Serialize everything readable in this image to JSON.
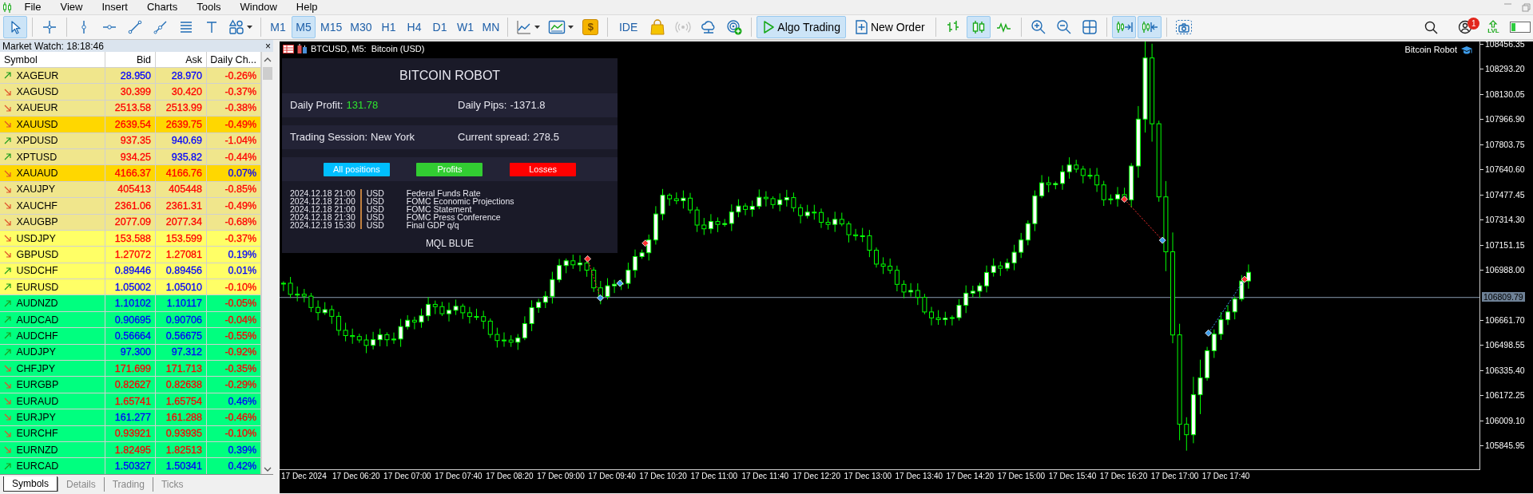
{
  "menu": [
    {
      "label": "File"
    },
    {
      "label": "View"
    },
    {
      "label": "Insert"
    },
    {
      "label": "Charts"
    },
    {
      "label": "Tools"
    },
    {
      "label": "Window"
    },
    {
      "label": "Help"
    }
  ],
  "toolbar": {
    "drawing_tools": [
      {
        "selected": true
      },
      {
        "selected": false
      },
      {
        "selected": false
      },
      {
        "selected": false
      },
      {
        "selected": false
      },
      {
        "selected": false
      },
      {
        "selected": false
      },
      {
        "selected": false
      },
      {
        "selected": false
      }
    ],
    "timeframes": [
      {
        "label": "M1",
        "selected": false
      },
      {
        "label": "M5",
        "selected": true
      },
      {
        "label": "M15",
        "selected": false
      },
      {
        "label": "M30",
        "selected": false
      },
      {
        "label": "H1",
        "selected": false
      },
      {
        "label": "H4",
        "selected": false
      },
      {
        "label": "D1",
        "selected": false
      },
      {
        "label": "W1",
        "selected": false
      },
      {
        "label": "MN",
        "selected": false
      }
    ],
    "dollar_symbol": "$",
    "ide": "IDE",
    "signals": {
      "disabled": true
    },
    "algo_trading": {
      "label": "Algo Trading",
      "on": true
    },
    "new_order": "New Order",
    "chart_types": [
      {
        "selected": false
      },
      {
        "selected": true
      },
      {
        "selected": false
      }
    ],
    "auto_scroll": {
      "on": true
    },
    "chart_shift": {
      "on": true
    },
    "notifications": "1",
    "lvl": {
      "label": "LVL",
      "level": 0.22
    }
  },
  "market_watch": {
    "title": "Market Watch: 18:18:46",
    "close": "×",
    "columns": [
      "Symbol",
      "Bid",
      "Ask",
      "Daily Ch..."
    ],
    "rows": [
      {
        "symbol": "XAGEUR",
        "kind": "up",
        "bid": {
          "value": "28.950",
          "color": "#0000ff"
        },
        "ask": {
          "value": "28.970",
          "color": "#0000ff"
        },
        "change": {
          "value": "-0.26%",
          "color": "#ff0000"
        },
        "color": "#f0e68c"
      },
      {
        "symbol": "XAGUSD",
        "kind": "down",
        "bid": {
          "value": "30.399",
          "color": "#ff0000"
        },
        "ask": {
          "value": "30.420",
          "color": "#ff0000"
        },
        "change": {
          "value": "-0.37%",
          "color": "#ff0000"
        },
        "color": "#f0e68c"
      },
      {
        "symbol": "XAUEUR",
        "kind": "down",
        "bid": {
          "value": "2513.58",
          "color": "#ff0000"
        },
        "ask": {
          "value": "2513.99",
          "color": "#ff0000"
        },
        "change": {
          "value": "-0.38%",
          "color": "#ff0000"
        },
        "color": "#f0e68c"
      },
      {
        "symbol": "XAUUSD",
        "kind": "down",
        "bid": {
          "value": "2639.54",
          "color": "#ff0000"
        },
        "ask": {
          "value": "2639.75",
          "color": "#ff0000"
        },
        "change": {
          "value": "-0.49%",
          "color": "#ff0000"
        },
        "color": "#ffd700"
      },
      {
        "symbol": "XPDUSD",
        "kind": "up",
        "bid": {
          "value": "937.35",
          "color": "#ff0000"
        },
        "ask": {
          "value": "940.69",
          "color": "#0000ff"
        },
        "change": {
          "value": "-1.04%",
          "color": "#ff0000"
        },
        "color": "#f0e68c"
      },
      {
        "symbol": "XPTUSD",
        "kind": "up",
        "bid": {
          "value": "934.25",
          "color": "#ff0000"
        },
        "ask": {
          "value": "935.82",
          "color": "#0000ff"
        },
        "change": {
          "value": "-0.44%",
          "color": "#ff0000"
        },
        "color": "#f0e68c"
      },
      {
        "symbol": "XAUAUD",
        "kind": "down",
        "bid": {
          "value": "4166.37",
          "color": "#ff0000"
        },
        "ask": {
          "value": "4166.76",
          "color": "#ff0000"
        },
        "change": {
          "value": "0.07%",
          "color": "#0000ff"
        },
        "color": "#ffd700"
      },
      {
        "symbol": "XAUJPY",
        "kind": "down",
        "bid": {
          "value": "405413",
          "color": "#ff0000"
        },
        "ask": {
          "value": "405448",
          "color": "#ff0000"
        },
        "change": {
          "value": "-0.85%",
          "color": "#ff0000"
        },
        "color": "#f0e68c"
      },
      {
        "symbol": "XAUCHF",
        "kind": "down",
        "bid": {
          "value": "2361.06",
          "color": "#ff0000"
        },
        "ask": {
          "value": "2361.31",
          "color": "#ff0000"
        },
        "change": {
          "value": "-0.49%",
          "color": "#ff0000"
        },
        "color": "#f0e68c"
      },
      {
        "symbol": "XAUGBP",
        "kind": "down",
        "bid": {
          "value": "2077.09",
          "color": "#ff0000"
        },
        "ask": {
          "value": "2077.34",
          "color": "#ff0000"
        },
        "change": {
          "value": "-0.68%",
          "color": "#ff0000"
        },
        "color": "#f0e68c"
      },
      {
        "symbol": "USDJPY",
        "kind": "down",
        "bid": {
          "value": "153.588",
          "color": "#ff0000"
        },
        "ask": {
          "value": "153.599",
          "color": "#ff0000"
        },
        "change": {
          "value": "-0.37%",
          "color": "#ff0000"
        },
        "color": "#ffff66"
      },
      {
        "symbol": "GBPUSD",
        "kind": "down",
        "bid": {
          "value": "1.27072",
          "color": "#ff0000"
        },
        "ask": {
          "value": "1.27081",
          "color": "#ff0000"
        },
        "change": {
          "value": "0.19%",
          "color": "#0000ff"
        },
        "color": "#ffff66"
      },
      {
        "symbol": "USDCHF",
        "kind": "up",
        "bid": {
          "value": "0.89446",
          "color": "#0000ff"
        },
        "ask": {
          "value": "0.89456",
          "color": "#0000ff"
        },
        "change": {
          "value": "0.01%",
          "color": "#0000ff"
        },
        "color": "#ffff66"
      },
      {
        "symbol": "EURUSD",
        "kind": "up",
        "bid": {
          "value": "1.05002",
          "color": "#0000ff"
        },
        "ask": {
          "value": "1.05010",
          "color": "#0000ff"
        },
        "change": {
          "value": "-0.10%",
          "color": "#ff0000"
        },
        "color": "#ffff66"
      },
      {
        "symbol": "AUDNZD",
        "kind": "up",
        "bid": {
          "value": "1.10102",
          "color": "#0000ff"
        },
        "ask": {
          "value": "1.10117",
          "color": "#0000ff"
        },
        "change": {
          "value": "-0.05%",
          "color": "#ff0000"
        },
        "color": "#00ff7f"
      },
      {
        "symbol": "AUDCAD",
        "kind": "up",
        "bid": {
          "value": "0.90695",
          "color": "#0000ff"
        },
        "ask": {
          "value": "0.90706",
          "color": "#0000ff"
        },
        "change": {
          "value": "-0.04%",
          "color": "#ff0000"
        },
        "color": "#00ff7f"
      },
      {
        "symbol": "AUDCHF",
        "kind": "up",
        "bid": {
          "value": "0.56664",
          "color": "#0000ff"
        },
        "ask": {
          "value": "0.56675",
          "color": "#0000ff"
        },
        "change": {
          "value": "-0.55%",
          "color": "#ff0000"
        },
        "color": "#00ff7f"
      },
      {
        "symbol": "AUDJPY",
        "kind": "up",
        "bid": {
          "value": "97.300",
          "color": "#0000ff"
        },
        "ask": {
          "value": "97.312",
          "color": "#0000ff"
        },
        "change": {
          "value": "-0.92%",
          "color": "#ff0000"
        },
        "color": "#00ff7f"
      },
      {
        "symbol": "CHFJPY",
        "kind": "down",
        "bid": {
          "value": "171.699",
          "color": "#ff0000"
        },
        "ask": {
          "value": "171.713",
          "color": "#ff0000"
        },
        "change": {
          "value": "-0.35%",
          "color": "#ff0000"
        },
        "color": "#00ff7f"
      },
      {
        "symbol": "EURGBP",
        "kind": "down",
        "bid": {
          "value": "0.82627",
          "color": "#ff0000"
        },
        "ask": {
          "value": "0.82638",
          "color": "#ff0000"
        },
        "change": {
          "value": "-0.29%",
          "color": "#ff0000"
        },
        "color": "#00ff7f"
      },
      {
        "symbol": "EURAUD",
        "kind": "down",
        "bid": {
          "value": "1.65741",
          "color": "#ff0000"
        },
        "ask": {
          "value": "1.65754",
          "color": "#ff0000"
        },
        "change": {
          "value": "0.46%",
          "color": "#0000ff"
        },
        "color": "#00ff7f"
      },
      {
        "symbol": "EURJPY",
        "kind": "down",
        "bid": {
          "value": "161.277",
          "color": "#0000ff"
        },
        "ask": {
          "value": "161.288",
          "color": "#ff0000"
        },
        "change": {
          "value": "-0.46%",
          "color": "#ff0000"
        },
        "color": "#00ff7f"
      },
      {
        "symbol": "EURCHF",
        "kind": "down",
        "bid": {
          "value": "0.93921",
          "color": "#ff0000"
        },
        "ask": {
          "value": "0.93935",
          "color": "#ff0000"
        },
        "change": {
          "value": "-0.10%",
          "color": "#ff0000"
        },
        "color": "#00ff7f"
      },
      {
        "symbol": "EURNZD",
        "kind": "down",
        "bid": {
          "value": "1.82495",
          "color": "#ff0000"
        },
        "ask": {
          "value": "1.82513",
          "color": "#ff0000"
        },
        "change": {
          "value": "0.39%",
          "color": "#0000ff"
        },
        "color": "#00ff7f"
      },
      {
        "symbol": "EURCAD",
        "kind": "up",
        "bid": {
          "value": "1.50327",
          "color": "#0000ff"
        },
        "ask": {
          "value": "1.50341",
          "color": "#0000ff"
        },
        "change": {
          "value": "0.42%",
          "color": "#0000ff"
        },
        "color": "#00ff7f"
      }
    ],
    "tabs": [
      {
        "label": "Symbols",
        "selected": true
      },
      {
        "label": "Details",
        "selected": false
      },
      {
        "label": "Trading",
        "selected": false
      },
      {
        "label": "Ticks",
        "selected": false
      }
    ]
  },
  "chart": {
    "title": "BTCUSD, M5:  Bitcoin (USD)",
    "expert": "Bitcoin Robot",
    "robot_panel": {
      "title": "BITCOIN ROBOT",
      "stats": [
        [
          {
            "label": "Daily Profit:",
            "value": "131.78",
            "color": "#2ee62e"
          },
          {
            "label": "Daily Pips:",
            "value": "-1371.8",
            "color": "#e8e8f0"
          }
        ],
        [
          {
            "label": "Trading Session:",
            "value": "New York",
            "color": "#e8e8f0"
          },
          {
            "label": "Current spread:",
            "value": "278.5",
            "color": "#e8e8f0"
          }
        ]
      ],
      "buttons": [
        {
          "label": "All positions",
          "color": "#00bfff"
        },
        {
          "label": "Profits",
          "color": "#32cd32"
        },
        {
          "label": "Losses",
          "color": "#ff0000"
        }
      ],
      "news": [
        {
          "time": "2024.12.18 21:00",
          "currency": "USD",
          "event": "Federal Funds Rate"
        },
        {
          "time": "2024.12.18 21:00",
          "currency": "USD",
          "event": "FOMC Economic Projections"
        },
        {
          "time": "2024.12.18 21:00",
          "currency": "USD",
          "event": "FOMC Statement"
        },
        {
          "time": "2024.12.18 21:30",
          "currency": "USD",
          "event": "FOMC Press Conference"
        },
        {
          "time": "2024.12.19 15:30",
          "currency": "USD",
          "event": "Final GDP q/q"
        }
      ],
      "footer": "MQL BLUE"
    },
    "price_axis": [
      "108456.35",
      "108293.20",
      "108130.05",
      "107966.90",
      "107803.75",
      "107640.60",
      "107477.45",
      "107314.30",
      "107151.15",
      "106988.00",
      "106661.70",
      "106498.55",
      "106335.40",
      "106172.25",
      "106009.10",
      "105845.95"
    ],
    "current_price": "106809.79",
    "time_axis": [
      "17 Dec 2024",
      "17 Dec 06:20",
      "17 Dec 07:00",
      "17 Dec 07:40",
      "17 Dec 08:20",
      "17 Dec 09:00",
      "17 Dec 09:40",
      "17 Dec 10:20",
      "17 Dec 11:00",
      "17 Dec 11:40",
      "17 Dec 12:20",
      "17 Dec 13:00",
      "17 Dec 13:40",
      "17 Dec 14:20",
      "17 Dec 15:00",
      "17 Dec 15:40",
      "17 Dec 16:20",
      "17 Dec 17:00",
      "17 Dec 17:40"
    ]
  }
}
